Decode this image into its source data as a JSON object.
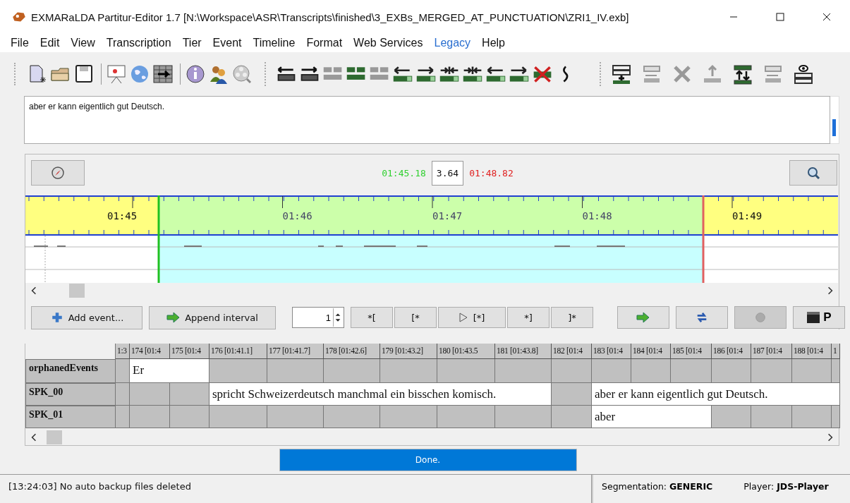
{
  "window": {
    "title": "EXMARaLDA Partitur-Editor 1.7 [N:\\Workspace\\ASR\\Transcripts\\finished\\3_EXBs_MERGED_AT_PUNCTUATION\\ZRI1_IV.exb]"
  },
  "menu": [
    {
      "label": "File",
      "highlighted": false
    },
    {
      "label": "Edit",
      "highlighted": false
    },
    {
      "label": "View",
      "highlighted": false
    },
    {
      "label": "Transcription",
      "highlighted": false
    },
    {
      "label": "Tier",
      "highlighted": false
    },
    {
      "label": "Event",
      "highlighted": false
    },
    {
      "label": "Timeline",
      "highlighted": false
    },
    {
      "label": "Format",
      "highlighted": false
    },
    {
      "label": "Web Services",
      "highlighted": false
    },
    {
      "label": "Legacy",
      "highlighted": true
    },
    {
      "label": "Help",
      "highlighted": false
    }
  ],
  "event_text": "aber er kann eigentlich gut Deutsch.",
  "selection": {
    "start": "01:45.18",
    "length": "3.64",
    "end": "01:48.82"
  },
  "ruler_labels": [
    "01:45",
    "01:46",
    "01:47",
    "01:48",
    "01:49"
  ],
  "controls": {
    "add_event": "Add event...",
    "append_interval": "Append interval",
    "count": "1",
    "brackets": [
      {
        "label": "*[",
        "kind": "text"
      },
      {
        "label": "[*",
        "kind": "text"
      },
      {
        "label": "[*]",
        "kind": "play"
      },
      {
        "label": "*]",
        "kind": "text"
      },
      {
        "label": "]*",
        "kind": "text"
      }
    ],
    "tools": [
      {
        "kind": "forward",
        "disabled": false
      },
      {
        "kind": "sync",
        "disabled": false
      },
      {
        "kind": "circle",
        "disabled": true
      },
      {
        "kind": "player",
        "label": "P",
        "disabled": false
      }
    ]
  },
  "partitur": {
    "columns": [
      "1:3",
      "174 [01:4",
      "175 [01:4",
      "176 [01:41.1]",
      "177 [01:41.7]",
      "178 [01:42.6]",
      "179 [01:43.2]",
      "180 [01:43.5",
      "181 [01:43.8]",
      "182 [01:4",
      "183 [01:4",
      "184 [01:4",
      "185 [01:4",
      "186 [01:4",
      "187 [01:4",
      "188 [01:4",
      "1"
    ],
    "tiers": [
      {
        "label": "orphanedEvents",
        "cells": [
          {
            "kind": "empty"
          },
          {
            "kind": "event",
            "text": "Er"
          },
          {
            "kind": "empty"
          },
          {
            "kind": "empty"
          },
          {
            "kind": "empty"
          },
          {
            "kind": "empty"
          },
          {
            "kind": "empty"
          },
          {
            "kind": "empty"
          },
          {
            "kind": "empty"
          },
          {
            "kind": "empty"
          },
          {
            "kind": "empty"
          },
          {
            "kind": "empty"
          },
          {
            "kind": "empty"
          },
          {
            "kind": "empty"
          },
          {
            "kind": "empty"
          },
          {
            "kind": "empty"
          }
        ]
      },
      {
        "label": "SPK_00",
        "cells": [
          {
            "kind": "empty"
          },
          {
            "kind": "empty"
          },
          {
            "kind": "empty"
          },
          {
            "kind": "event",
            "text": "spricht Schweizerdeutsch manchmal ein bisschen komisch."
          },
          {
            "kind": "empty"
          },
          {
            "kind": "event",
            "text": "aber er kann eigentlich gut Deutsch."
          }
        ]
      },
      {
        "label": "SPK_01",
        "cells": [
          {
            "kind": "empty"
          },
          {
            "kind": "empty"
          },
          {
            "kind": "empty"
          },
          {
            "kind": "empty"
          },
          {
            "kind": "empty"
          },
          {
            "kind": "empty"
          },
          {
            "kind": "empty"
          },
          {
            "kind": "empty"
          },
          {
            "kind": "empty"
          },
          {
            "kind": "empty"
          },
          {
            "kind": "event",
            "text": "aber"
          },
          {
            "kind": "empty"
          },
          {
            "kind": "empty"
          },
          {
            "kind": "empty"
          },
          {
            "kind": "empty"
          }
        ]
      }
    ]
  },
  "progress": {
    "label": "Done.",
    "level": 1
  },
  "status_bar": {
    "message": "[13:24:03] No auto backup files deleted",
    "segmentation": "Segmentation: **GENERIC**",
    "player": "Player: **JDS-Player**"
  }
}
